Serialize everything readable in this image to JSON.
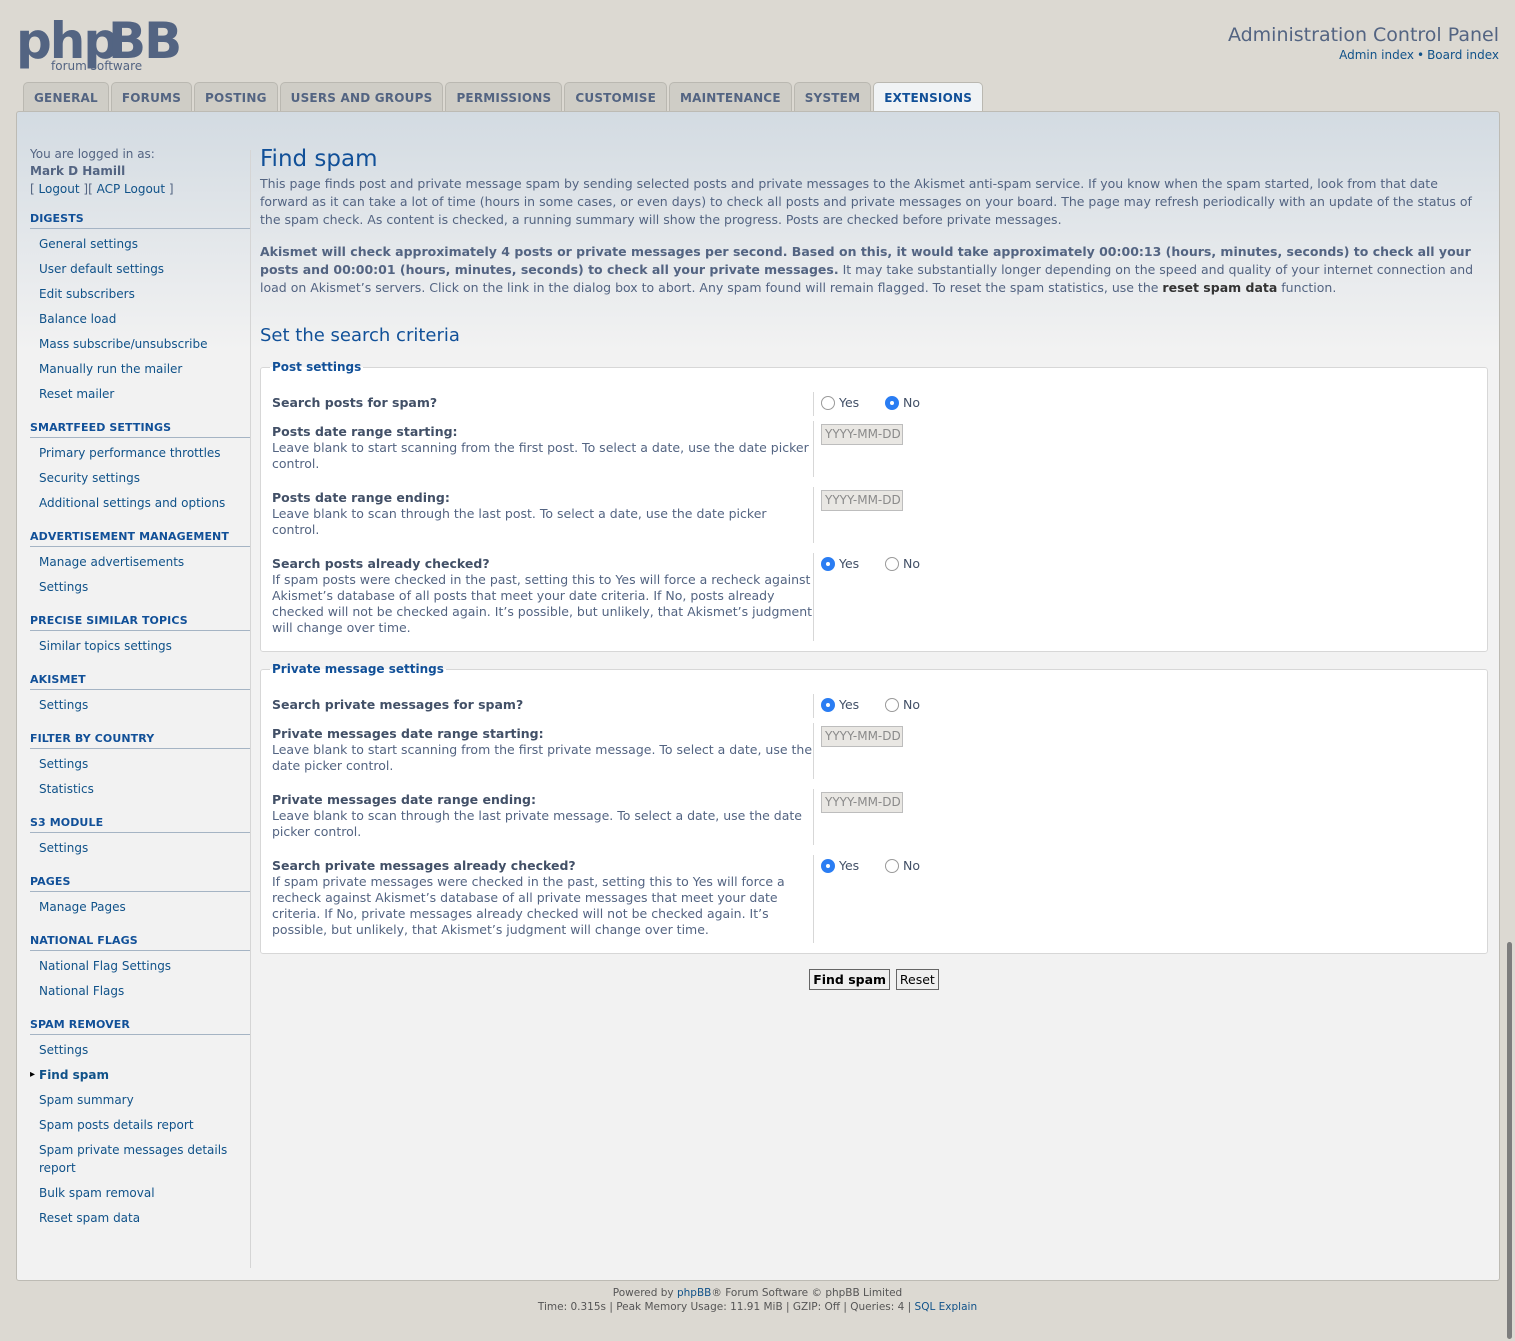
{
  "header": {
    "logo_text": "phpBB",
    "logo_sub": "forum software",
    "title": "Administration Control Panel",
    "links": [
      "Admin index",
      "Board index"
    ],
    "link_sep": "•"
  },
  "tabs": [
    "GENERAL",
    "FORUMS",
    "POSTING",
    "USERS AND GROUPS",
    "PERMISSIONS",
    "CUSTOMISE",
    "MAINTENANCE",
    "SYSTEM",
    "EXTENSIONS"
  ],
  "active_tab": "EXTENSIONS",
  "menu": {
    "logged_in_label": "You are logged in as:",
    "user": "Mark D Hamill",
    "logout": "Logout",
    "acp_logout": "ACP Logout",
    "sections": [
      {
        "title": "DIGESTS",
        "items": [
          "General settings",
          "User default settings",
          "Edit subscribers",
          "Balance load",
          "Mass subscribe/unsubscribe",
          "Manually run the mailer",
          "Reset mailer"
        ]
      },
      {
        "title": "SMARTFEED SETTINGS",
        "items": [
          "Primary performance throttles",
          "Security settings",
          "Additional settings and options"
        ]
      },
      {
        "title": "ADVERTISEMENT MANAGEMENT",
        "items": [
          "Manage advertisements",
          "Settings"
        ]
      },
      {
        "title": "PRECISE SIMILAR TOPICS",
        "items": [
          "Similar topics settings"
        ]
      },
      {
        "title": "AKISMET",
        "items": [
          "Settings"
        ]
      },
      {
        "title": "FILTER BY COUNTRY",
        "items": [
          "Settings",
          "Statistics"
        ]
      },
      {
        "title": "S3 MODULE",
        "items": [
          "Settings"
        ]
      },
      {
        "title": "PAGES",
        "items": [
          "Manage Pages"
        ]
      },
      {
        "title": "NATIONAL FLAGS",
        "items": [
          "National Flag Settings",
          "National Flags"
        ]
      },
      {
        "title": "SPAM REMOVER",
        "items": [
          "Settings",
          "Find spam",
          "Spam summary",
          "Spam posts details report",
          "Spam private messages details report",
          "Bulk spam removal",
          "Reset spam data"
        ]
      }
    ],
    "active_item": "Find spam"
  },
  "content": {
    "title": "Find spam",
    "intro": "This page finds post and private message spam by sending selected posts and private messages to the Akismet anti-spam service. If you know when the spam started, look from that date forward as it can take a lot of time (hours in some cases, or even days) to check all posts and private messages on your board. The page may refresh periodically with an update of the status of the spam check. As content is checked, a running summary will show the progress. Posts are checked before private messages.",
    "estimate_bold": "Akismet will check approximately 4 posts or private messages per second. Based on this, it would take approximately 00:00:13 (hours, minutes, seconds) to check all your posts and 00:00:01 (hours, minutes, seconds) to check all your private messages.",
    "estimate_rest": " It may take substantially longer depending on the speed and quality of your internet connection and load on Akismet’s servers. Click on the link in the dialog box to abort. Any spam found will remain flagged. To reset the spam statistics, use the ",
    "reset_link": "reset spam data",
    "estimate_end": " function.",
    "criteria_title": "Set the search criteria",
    "post_settings": {
      "legend": "Post settings",
      "search_label": "Search posts for spam?",
      "start_label": "Posts date range starting:",
      "start_desc": "Leave blank to start scanning from the first post. To select a date, use the date picker control.",
      "end_label": "Posts date range ending:",
      "end_desc": "Leave blank to scan through the last post. To select a date, use the date picker control.",
      "checked_label": "Search posts already checked?",
      "checked_desc": "If spam posts were checked in the past, setting this to Yes will force a recheck against Akismet’s database of all posts that meet your date criteria. If No, posts already checked will not be checked again. It’s possible, but unlikely, that Akismet’s judgment will change over time."
    },
    "pm_settings": {
      "legend": "Private message settings",
      "search_label": "Search private messages for spam?",
      "start_label": "Private messages date range starting:",
      "start_desc": "Leave blank to start scanning from the first private message. To select a date, use the date picker control.",
      "end_label": "Private messages date range ending:",
      "end_desc": "Leave blank to scan through the last private message. To select a date, use the date picker control.",
      "checked_label": "Search private messages already checked?",
      "checked_desc": "If spam private messages were checked in the past, setting this to Yes will force a recheck against Akismet’s database of all private messages that meet your date criteria. If No, private messages already checked will not be checked again. It’s possible, but unlikely, that Akismet’s judgment will change over time."
    },
    "yes": "Yes",
    "no": "No",
    "date_placeholder": "YYYY-MM-DD",
    "find_button": "Find spam",
    "reset_button": "Reset"
  },
  "radios": {
    "search_posts": "No",
    "posts_checked": "Yes",
    "search_pms": "Yes",
    "pms_checked": "Yes"
  },
  "footer": {
    "powered_pre": "Powered by ",
    "powered_link": "phpBB",
    "powered_post": "® Forum Software © phpBB Limited",
    "stats": "Time: 0.315s | Peak Memory Usage: 11.91 MiB | GZIP: Off | Queries: 4 | ",
    "sql_explain": "SQL Explain"
  }
}
